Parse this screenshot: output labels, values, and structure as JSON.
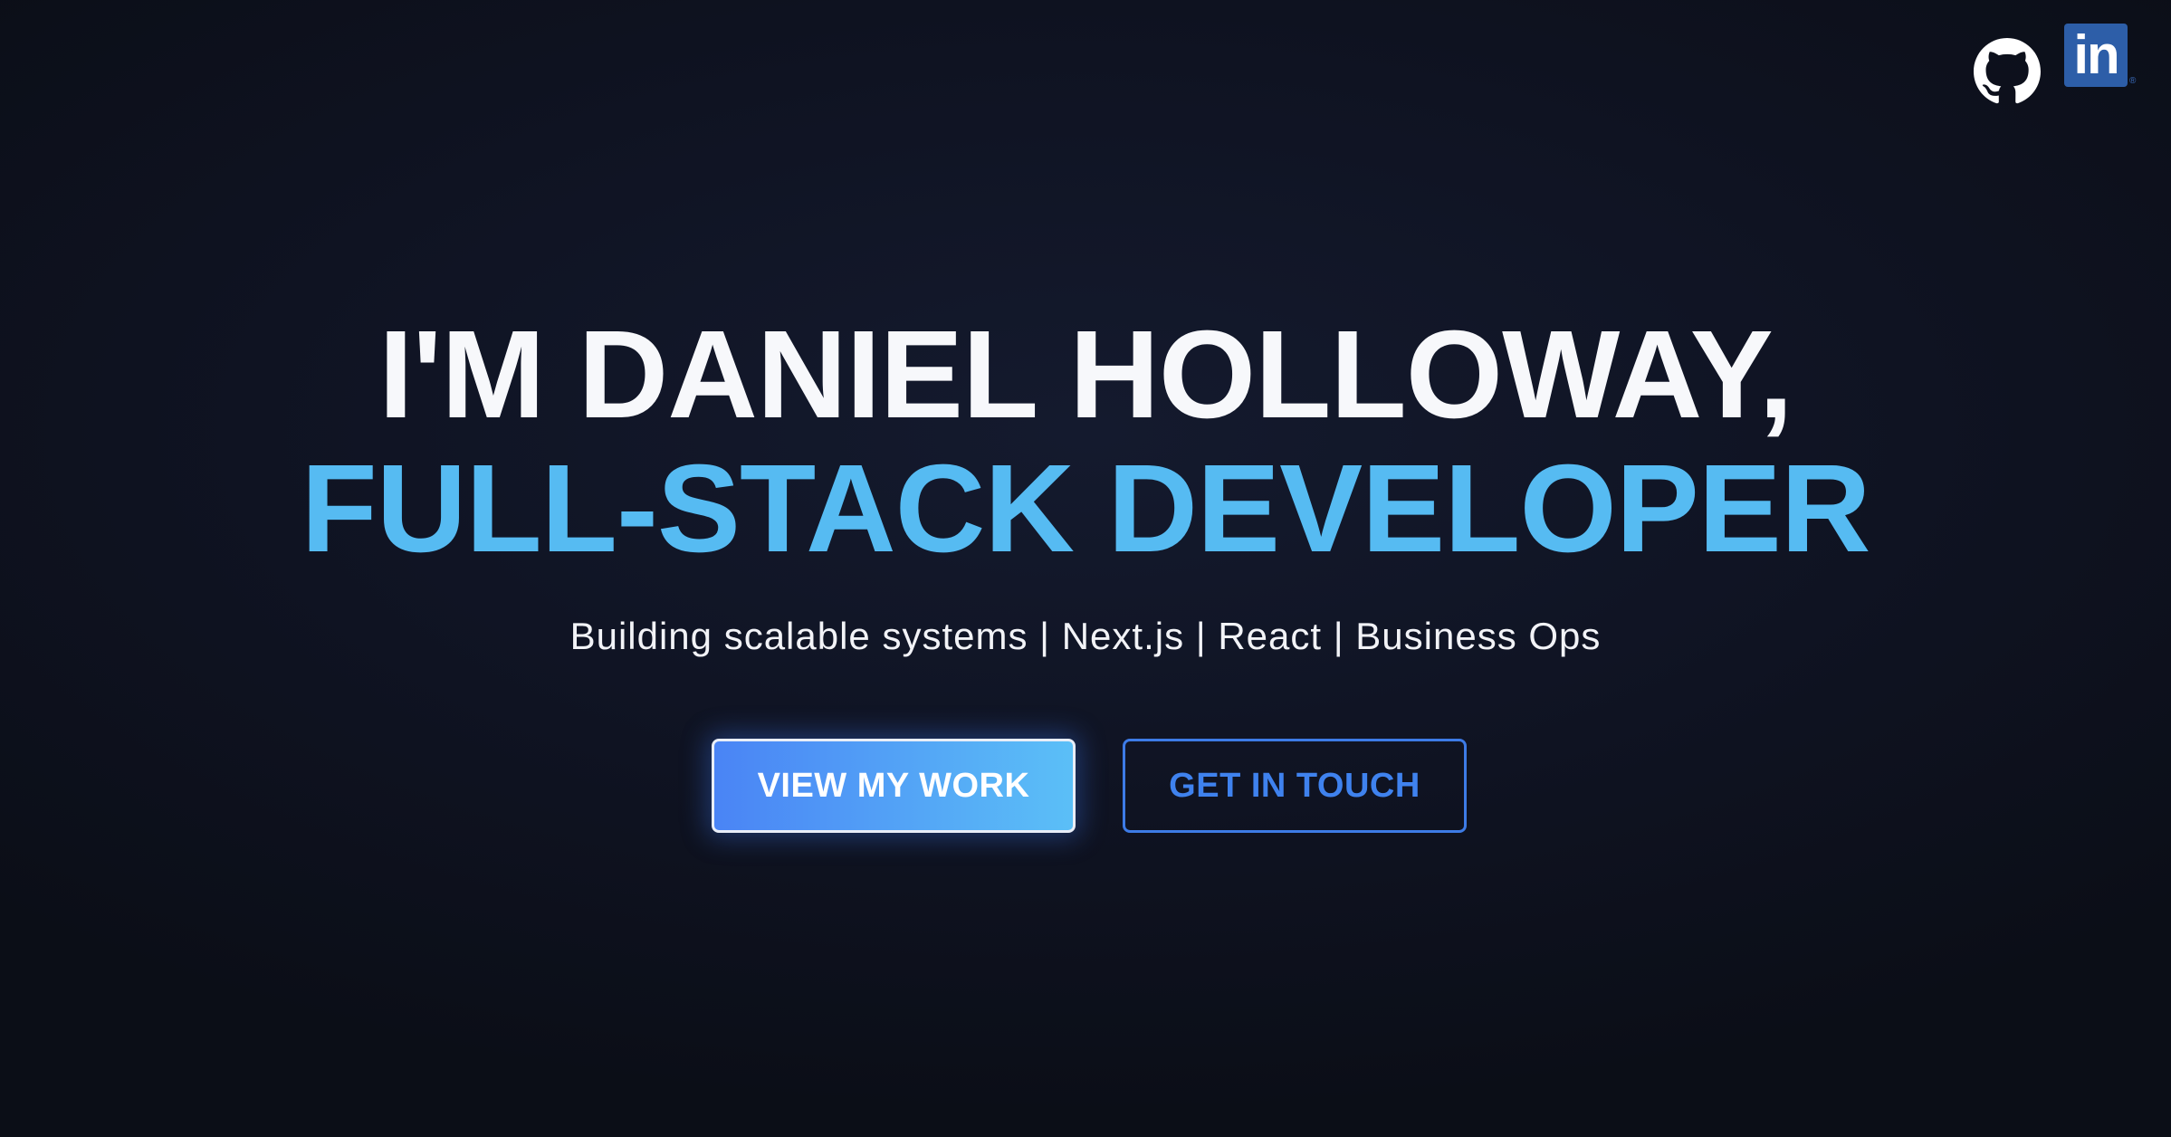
{
  "social": {
    "github_icon": "github-icon",
    "linkedin_icon": "linkedin-icon",
    "linkedin_text": "in",
    "linkedin_mark": "®"
  },
  "hero": {
    "headline_line1": "I'M DANIEL HOLLOWAY,",
    "headline_line2": "FULL-STACK DEVELOPER",
    "subtitle": "Building scalable systems | Next.js | React | Business Ops"
  },
  "buttons": {
    "primary_label": "VIEW MY WORK",
    "secondary_label": "GET IN TOUCH"
  },
  "colors": {
    "background": "#0f1322",
    "accent_blue": "#56bbf2",
    "button_blue": "#4a84f5",
    "linkedin_blue": "#2d5ea8"
  }
}
